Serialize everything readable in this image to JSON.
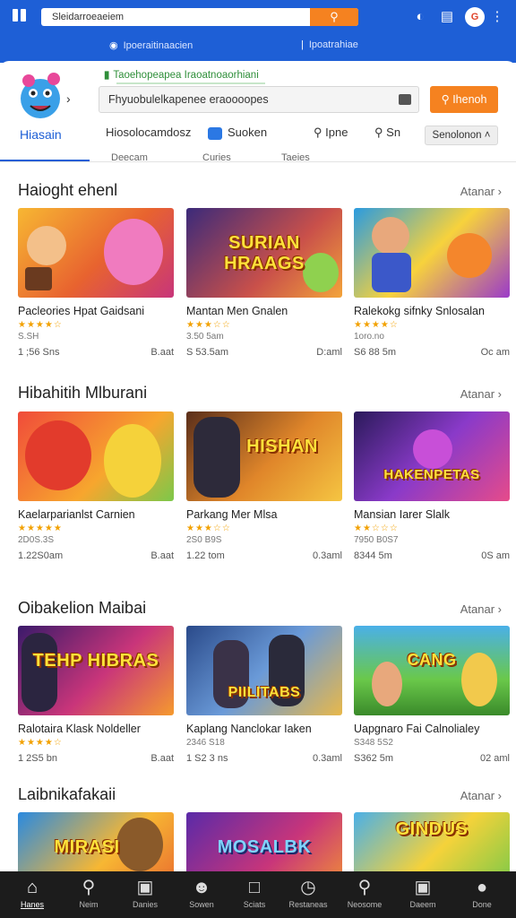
{
  "browser": {
    "url": "Sleidarroeaeiem",
    "go_icon": "search-icon",
    "tabs": [
      {
        "label": "Ipoeraitinaacien"
      },
      {
        "label": "Ipoatrahiae"
      }
    ]
  },
  "header": {
    "notice": "Taoehopeapea Iraoatnoaorhiani",
    "search_placeholder": "Fhyuobulelkapenee eraoooopes",
    "search_button": "Ihenoh",
    "nav": [
      {
        "label": "Hiasain",
        "active": true
      },
      {
        "label": "Hiosolocamdosz"
      },
      {
        "label": "Suoken"
      },
      {
        "label": "Ipne"
      },
      {
        "label": "Sn"
      }
    ],
    "nav_chip": "Senolonon",
    "subnav": [
      "Deecam",
      "Curies",
      "Taeies"
    ]
  },
  "sections": [
    {
      "title": "Haioght ehenl",
      "more": "Atanar",
      "cards": [
        {
          "title": "Pacleories Hpat Gaidsani",
          "stars": "★★★★☆",
          "sub": "S.SH",
          "left": "1 ;56 Sns",
          "right": "B.aat"
        },
        {
          "title": "Mantan Men Gnalen",
          "stars": "★★★☆☆",
          "sub": "3.50 5am",
          "left": "S 53.5am",
          "right": "D:aml",
          "banner": "SURIAN HRAAGS"
        },
        {
          "title": "Ralekokg sifnky Snlosalan",
          "stars": "★★★★☆",
          "sub": "1oro.no",
          "left": "S6 88 5m",
          "right": "Oc am"
        }
      ]
    },
    {
      "title": "Hibahitih Mlburani",
      "more": "Atanar",
      "cards": [
        {
          "title": "Kaelarparianlst Carnien",
          "stars": "★★★★★",
          "sub": "2D0S.3S",
          "left": "1.22S0am",
          "right": "B.aat"
        },
        {
          "title": "Parkang Mer Mlsa",
          "stars": "★★★☆☆",
          "sub": "2S0 B9S",
          "left": "1.22 tom",
          "right": "0.3aml",
          "banner": "HISHAN"
        },
        {
          "title": "Mansian Iarer Slalk",
          "stars": "★★☆☆☆",
          "sub": "7950 B0S7",
          "left": "8344 5m",
          "right": "0S am",
          "banner": "HAKENPETAS"
        }
      ]
    },
    {
      "title": "Oibakelion Maibai",
      "more": "Atanar",
      "cards": [
        {
          "title": "Ralotaira Klask Noldeller",
          "stars": "★★★★☆",
          "sub": "",
          "left": "1 2S5 bn",
          "right": "B.aat",
          "banner": "TEHP HIBRAS"
        },
        {
          "title": "Kaplang Nanclokar Iaken",
          "stars": "",
          "sub": "2346 S18",
          "left": "1 S2 3 ns",
          "right": "0.3aml",
          "banner": "PIILITABS"
        },
        {
          "title": "Uapgnaro Fai Calnolialey",
          "stars": "",
          "sub": "S348 5S2",
          "left": "S362 5m",
          "right": "02 aml",
          "banner": "CANG"
        }
      ]
    },
    {
      "title": "Laibnikafakaii",
      "more": "Atanar",
      "cards": [
        {
          "title": "",
          "stars": "",
          "sub": "",
          "left": "",
          "right": "",
          "banner": "MIRASI"
        },
        {
          "title": "",
          "stars": "",
          "sub": "",
          "left": "",
          "right": "",
          "banner": "MOSALBK"
        },
        {
          "title": "",
          "stars": "",
          "sub": "",
          "left": "",
          "right": "",
          "banner": "GINDUS"
        }
      ]
    }
  ],
  "bottom_nav": [
    {
      "label": "Hanes",
      "icon": "home-icon",
      "active": true
    },
    {
      "label": "Neim",
      "icon": "search-icon"
    },
    {
      "label": "Danies",
      "icon": "tablet-icon"
    },
    {
      "label": "Sowen",
      "icon": "user-icon"
    },
    {
      "label": "Sciats",
      "icon": "square-icon"
    },
    {
      "label": "Restaneas",
      "icon": "clock-icon"
    },
    {
      "label": "Neosome",
      "icon": "search-icon"
    },
    {
      "label": "Daeem",
      "icon": "tablet-icon"
    },
    {
      "label": "Done",
      "icon": "account-icon"
    }
  ],
  "colors": {
    "brand": "#1e5fd6",
    "accent": "#f58220",
    "stars": "#f2a100"
  }
}
